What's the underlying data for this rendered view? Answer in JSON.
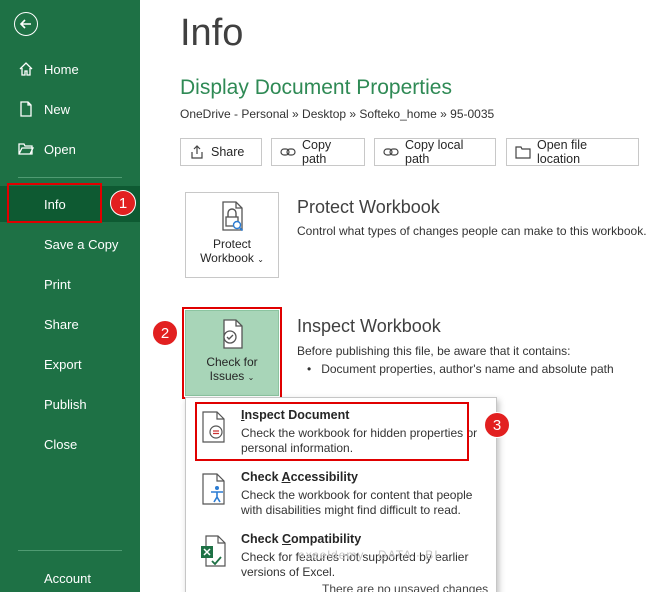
{
  "sidebar": {
    "items": [
      {
        "label": "Home"
      },
      {
        "label": "New"
      },
      {
        "label": "Open"
      },
      {
        "label": "Info"
      },
      {
        "label": "Save a Copy"
      },
      {
        "label": "Print"
      },
      {
        "label": "Share"
      },
      {
        "label": "Export"
      },
      {
        "label": "Publish"
      },
      {
        "label": "Close"
      },
      {
        "label": "Account"
      }
    ]
  },
  "steps": [
    "1",
    "2",
    "3"
  ],
  "main": {
    "title": "Info",
    "section_title": "Display Document Properties",
    "path": "OneDrive - Personal » Desktop » Softeko_home » 95-0035",
    "buttons": {
      "share": "Share",
      "copy_path": "Copy path",
      "copy_local_path": "Copy local path",
      "open_file_location": "Open file location"
    },
    "protect": {
      "btn_line1": "Protect",
      "btn_line2": "Workbook",
      "title": "Protect Workbook",
      "desc": "Control what types of changes people can make to this workbook."
    },
    "inspect": {
      "btn_line1": "Check for",
      "btn_line2": "Issues",
      "title": "Inspect Workbook",
      "desc": "Before publishing this file, be aware that it contains:",
      "bullet": "Document properties, author's name and absolute path"
    }
  },
  "dropdown": {
    "items": [
      {
        "title_u": "I",
        "title_rest": "nspect Document",
        "desc": "Check the workbook for hidden properties or personal information."
      },
      {
        "title_pre": "Check ",
        "title_u": "A",
        "title_rest": "ccessibility",
        "desc": "Check the workbook for content that people with disabilities might find difficult to read."
      },
      {
        "title_pre": "Check ",
        "title_u": "C",
        "title_rest": "ompatibility",
        "desc": "Check for features not supported by earlier versions of Excel."
      }
    ]
  },
  "watermark": "exceldemy · DATA · BI",
  "bottom_peek": "There are no unsaved changes",
  "colors": {
    "sidebar": "#1e7145",
    "accent": "#2f8a55",
    "highlight": "#e00000"
  }
}
